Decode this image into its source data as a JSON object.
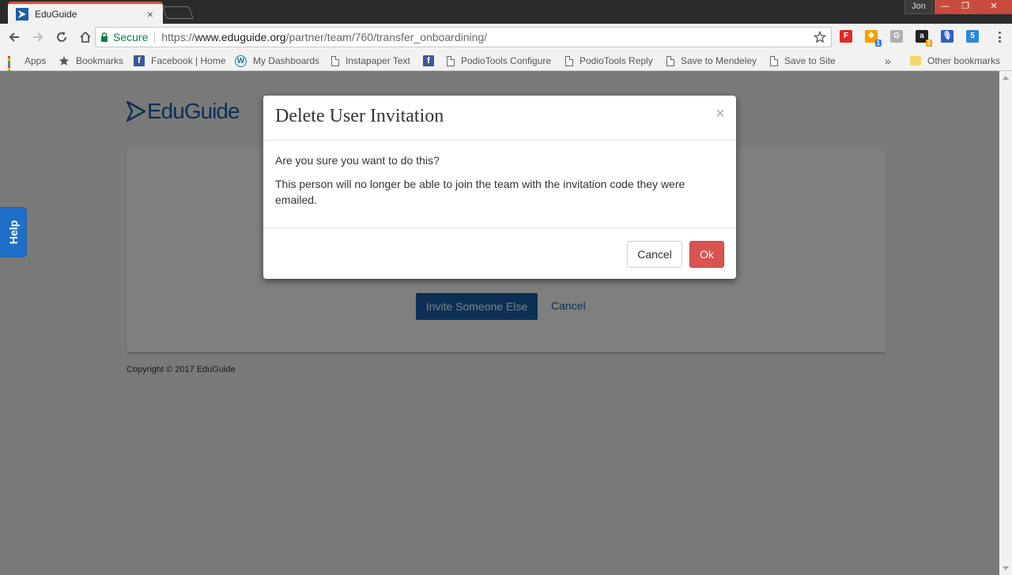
{
  "browser": {
    "tab_title": "EduGuide",
    "tab_close": "×",
    "profile_name": "Jon",
    "window_controls": {
      "minimize": "—",
      "restore": "❐",
      "close": "✕"
    },
    "secure_label": "Secure",
    "url_scheme": "https://",
    "url_host": "www.eduguide.org",
    "url_path": "/partner/team/760/transfer_onboardining/",
    "extensions": [
      {
        "name": "flipboard-extension-icon",
        "glyph": "F",
        "color": "#e12828"
      },
      {
        "name": "rss-extension-icon",
        "glyph": "❖",
        "color": "#f4a000",
        "badge": "1",
        "badge_color": "#3b7ddd"
      },
      {
        "name": "g-extension-icon",
        "glyph": "G",
        "color": "#b0b0b0"
      },
      {
        "name": "amazon-extension-icon",
        "glyph": "a",
        "color": "#222222",
        "badge": "3",
        "badge_color": "#f4a000"
      },
      {
        "name": "microphone-extension-icon",
        "glyph": "🎙",
        "color": "#2d5fc4"
      },
      {
        "name": "five-extension-icon",
        "glyph": "5",
        "color": "#2d8ad8"
      }
    ]
  },
  "bookmarks": {
    "apps": "Apps",
    "bookmarks": "Bookmarks",
    "facebook_home": "Facebook | Home",
    "my_dashboards": "My Dashboards",
    "instapaper": "Instapaper Text",
    "podiotools_configure": "PodioTools Configure",
    "podiotools_reply": "PodioTools Reply",
    "save_to_mendeley": "Save to Mendeley",
    "save_to_site": "Save to Site",
    "overflow": "»",
    "other_bookmarks": "Other bookmarks"
  },
  "page": {
    "logo_text": "EduGuide",
    "invite_button": "Invite Someone Else",
    "cancel_link": "Cancel",
    "copyright": "Copyright © 2017 EduGuide",
    "help_tab": "Help"
  },
  "modal": {
    "title": "Delete User Invitation",
    "close": "×",
    "question": "Are you sure you want to do this?",
    "detail": "This person will no longer be able to join the team with the invitation code they were emailed.",
    "cancel_button": "Cancel",
    "ok_button": "Ok"
  },
  "colors": {
    "brand_blue": "#1a5fa8",
    "danger": "#d9534f",
    "secure_green": "#0b8043"
  }
}
